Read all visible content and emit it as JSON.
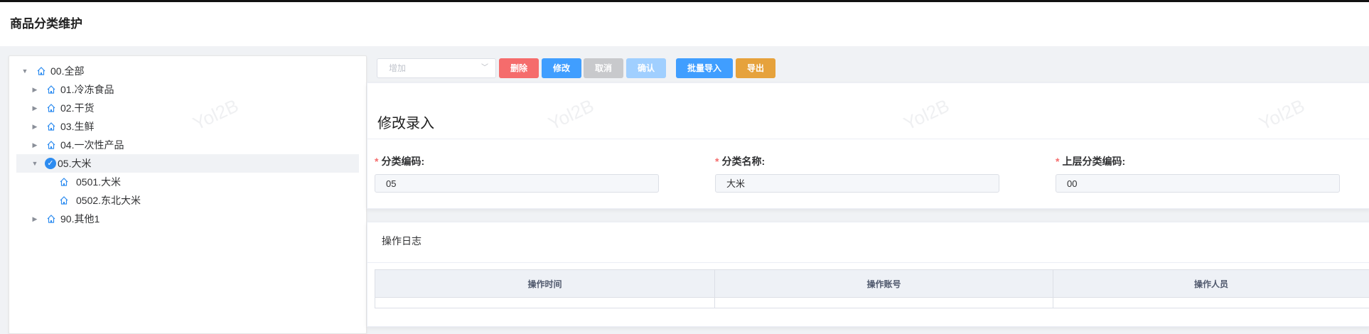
{
  "page": {
    "title": "商品分类维护"
  },
  "watermark": "Yol2B",
  "tree": {
    "items": [
      {
        "label": "00.全部",
        "level": 0,
        "expanded": true
      },
      {
        "label": "01.冷冻食品",
        "level": 1,
        "expanded": false
      },
      {
        "label": "02.干货",
        "level": 1,
        "expanded": false
      },
      {
        "label": "03.生鲜",
        "level": 1,
        "expanded": false
      },
      {
        "label": "04.一次性产品",
        "level": 1,
        "expanded": false
      },
      {
        "label": "05.大米",
        "level": 1,
        "expanded": true,
        "selected": true
      },
      {
        "label": "0501.大米",
        "level": 2
      },
      {
        "label": "0502.东北大米",
        "level": 2
      },
      {
        "label": "90.其他1",
        "level": 1,
        "expanded": false
      }
    ]
  },
  "toolbar": {
    "add_placeholder": "增加",
    "delete_label": "删除",
    "modify_label": "修改",
    "cancel_label": "取消",
    "confirm_label": "确认",
    "import_label": "批量导入",
    "export_label": "导出"
  },
  "form": {
    "title": "修改录入",
    "code_label": "分类编码:",
    "code_value": "05",
    "name_label": "分类名称:",
    "name_value": "大米",
    "parent_label": "上层分类编码:",
    "parent_value": "00",
    "required_mark": "*"
  },
  "log": {
    "title": "操作日志",
    "columns": [
      "操作时间",
      "操作账号",
      "操作人员"
    ]
  },
  "colors": {
    "danger": "#f56c6c",
    "primary": "#409eff",
    "disabled": "#c8c9cc",
    "light_primary": "#a0cfff",
    "warning": "#e6a23c"
  }
}
